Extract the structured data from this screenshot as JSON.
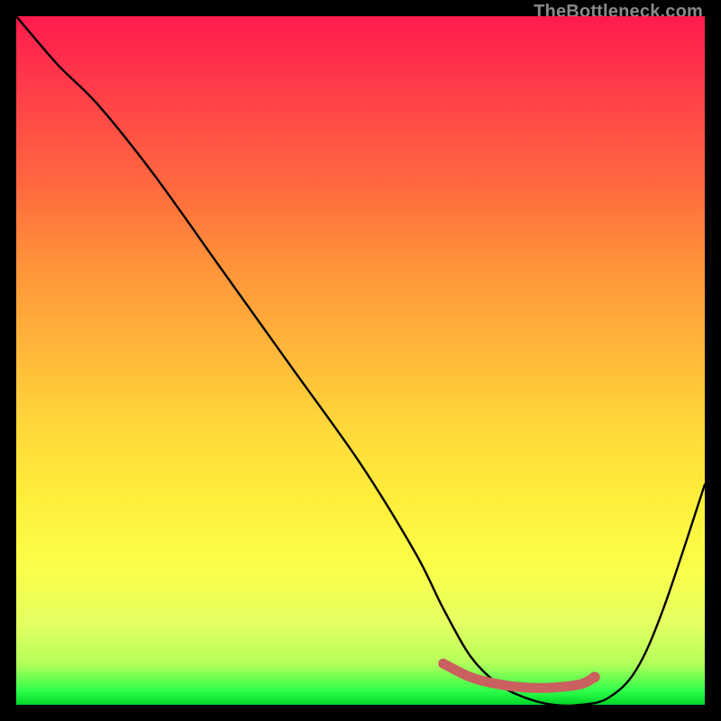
{
  "watermark": "TheBottleneck.com",
  "chart_data": {
    "type": "line",
    "title": "",
    "xlabel": "",
    "ylabel": "",
    "xlim": [
      0,
      100
    ],
    "ylim": [
      0,
      100
    ],
    "grid": false,
    "legend": false,
    "series": [
      {
        "name": "bottleneck-curve",
        "x": [
          0,
          6,
          12,
          20,
          30,
          40,
          50,
          58,
          62,
          66,
          70,
          74,
          78,
          82,
          86,
          90,
          94,
          100
        ],
        "y": [
          100,
          93,
          87,
          77,
          63,
          49,
          35,
          22,
          14,
          7,
          3,
          1,
          0,
          0,
          1,
          5,
          14,
          32
        ]
      },
      {
        "name": "highlight-band",
        "x": [
          62,
          66,
          70,
          74,
          78,
          82,
          84
        ],
        "y": [
          6,
          4,
          3,
          2.5,
          2.5,
          3,
          4
        ]
      }
    ],
    "background_gradient": {
      "stops": [
        {
          "pos": 0,
          "color": "#ff1a4d"
        },
        {
          "pos": 10,
          "color": "#ff3b4a"
        },
        {
          "pos": 25,
          "color": "#ff6a3e"
        },
        {
          "pos": 35,
          "color": "#ff8f3a"
        },
        {
          "pos": 48,
          "color": "#ffb53a"
        },
        {
          "pos": 60,
          "color": "#ffd93a"
        },
        {
          "pos": 70,
          "color": "#ffee3a"
        },
        {
          "pos": 80,
          "color": "#fbff4a"
        },
        {
          "pos": 88,
          "color": "#e6ff61"
        },
        {
          "pos": 94,
          "color": "#b4ff5a"
        },
        {
          "pos": 98,
          "color": "#2fff4a"
        },
        {
          "pos": 100,
          "color": "#00d628"
        }
      ]
    },
    "colors": {
      "curve": "#000000",
      "highlight": "#c9605f",
      "frame": "#000000"
    }
  }
}
